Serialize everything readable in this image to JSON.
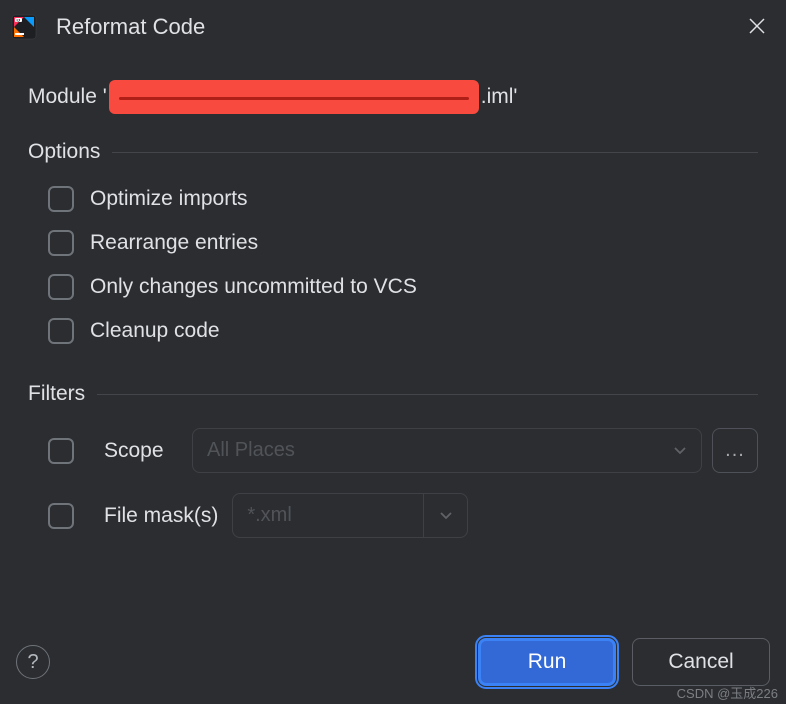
{
  "titlebar": {
    "title": "Reformat Code"
  },
  "module": {
    "prefix": "Module '",
    "suffix": ".iml'"
  },
  "sections": {
    "options": "Options",
    "filters": "Filters"
  },
  "options": {
    "optimize_imports": "Optimize imports",
    "rearrange_entries": "Rearrange entries",
    "only_vcs_changes": "Only changes uncommitted to VCS",
    "cleanup_code": "Cleanup code"
  },
  "filters": {
    "scope_label": "Scope",
    "scope_value": "All Places",
    "ellipsis": "...",
    "file_mask_label": "File mask(s)",
    "file_mask_placeholder": "*.xml"
  },
  "buttons": {
    "run": "Run",
    "cancel": "Cancel",
    "help": "?"
  },
  "watermark": "CSDN @玉成226"
}
